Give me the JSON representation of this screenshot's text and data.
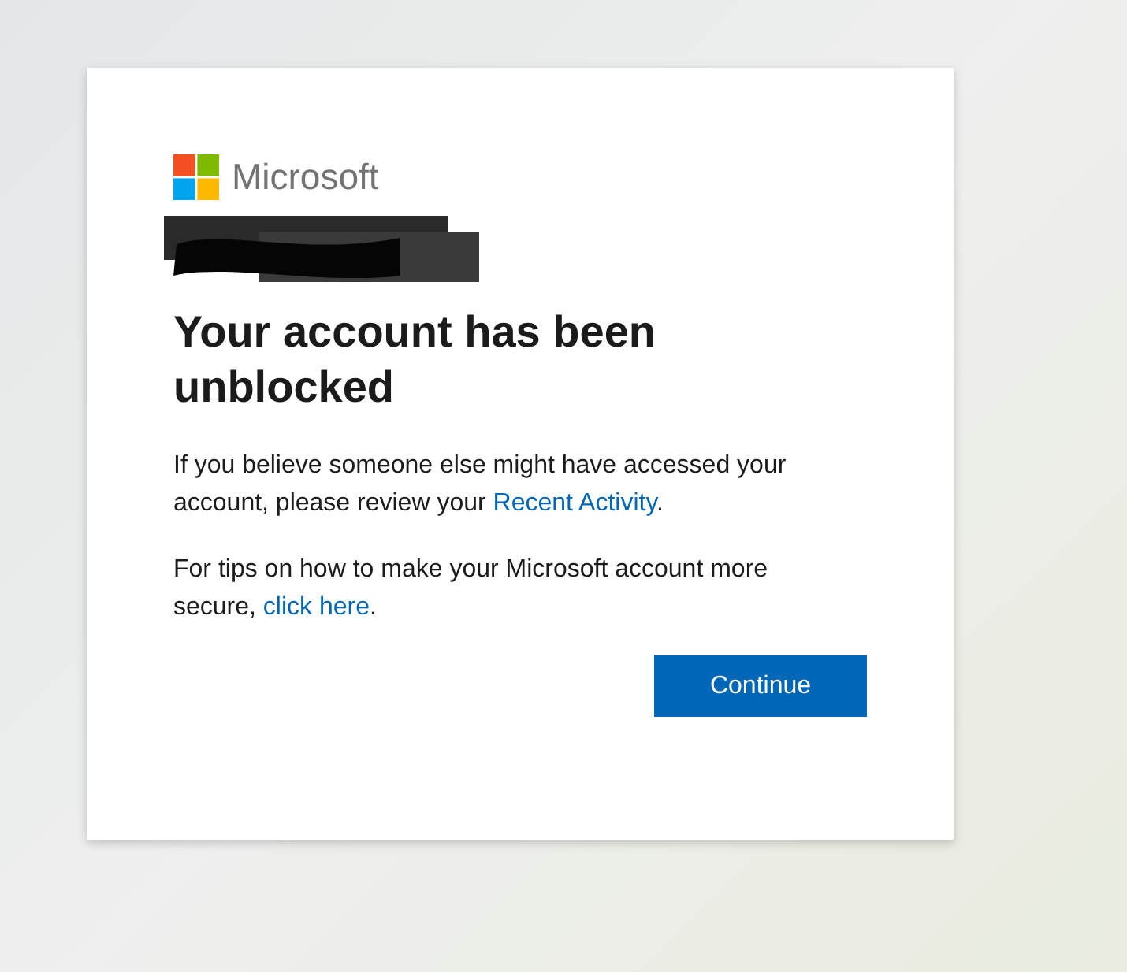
{
  "logo": {
    "name": "Microsoft"
  },
  "redacted_account": {
    "kind": "redacted"
  },
  "heading": "Your account has been unblocked",
  "paragraphs": [
    {
      "parts": [
        {
          "kind": "text",
          "text": "If you believe someone else might have accessed your account, please review your "
        },
        {
          "kind": "link",
          "text": "Recent Activity"
        },
        {
          "kind": "text",
          "text": "."
        }
      ]
    },
    {
      "parts": [
        {
          "kind": "text",
          "text": "For tips on how to make your Microsoft account more secure, "
        },
        {
          "kind": "link",
          "text": "click here"
        },
        {
          "kind": "text",
          "text": "."
        }
      ]
    }
  ],
  "buttons": [
    {
      "label": "Continue"
    }
  ]
}
